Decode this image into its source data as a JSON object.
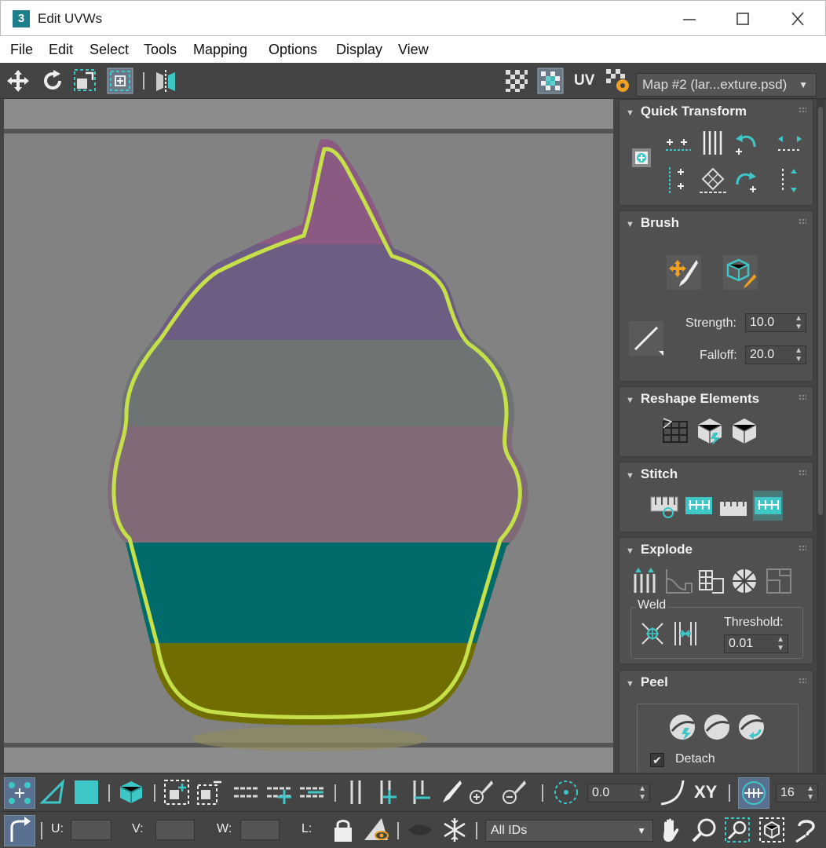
{
  "window": {
    "title": "Edit UVWs",
    "app_badge": "3"
  },
  "menu": [
    "File",
    "Edit",
    "Select",
    "Tools",
    "Mapping",
    "Options",
    "Display",
    "View"
  ],
  "toolbar": {
    "uv_label": "UV",
    "map_selector": "Map #2 (lar...exture.psd)"
  },
  "quick_transform": {
    "title": "Quick Transform"
  },
  "brush": {
    "title": "Brush",
    "strength_label": "Strength:",
    "strength_value": "10.0",
    "falloff_label": "Falloff:",
    "falloff_value": "20.0"
  },
  "reshape": {
    "title": "Reshape Elements"
  },
  "stitch": {
    "title": "Stitch"
  },
  "explode": {
    "title": "Explode",
    "weld_label": "Weld",
    "threshold_label": "Threshold:",
    "threshold_value": "0.01"
  },
  "peel": {
    "title": "Peel",
    "detach_label": "Detach",
    "detach_checked": true
  },
  "bottom": {
    "angle_value": "0.0",
    "xy_label": "XY",
    "pixel_value": "16",
    "u_label": "U:",
    "v_label": "V:",
    "w_label": "W:",
    "l_label": "L:",
    "ids_value": "All IDs"
  },
  "colors": {
    "accent": "#3ec7c7",
    "uv_outline": "#c6e04a",
    "frosting_top": "#8a5a82",
    "frosting_mid": "#6e5d82",
    "band_gray": "#6e7474",
    "band_mauve": "#806a78",
    "band_teal": "#006b6a",
    "band_olive": "#706e00"
  }
}
